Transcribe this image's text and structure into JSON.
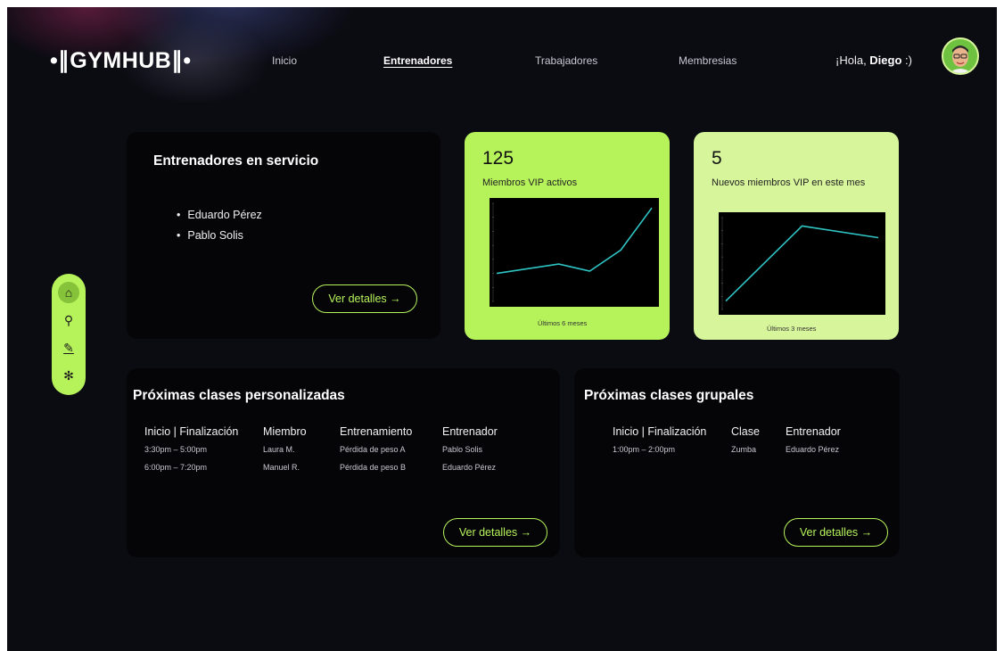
{
  "header": {
    "logo": "•∥GYMHUB∥•",
    "nav": [
      {
        "label": "Inicio"
      },
      {
        "label": "Entrenadores"
      },
      {
        "label": "Trabajadores"
      },
      {
        "label": "Membresias"
      }
    ],
    "greeting_prefix": "¡Hola, ",
    "user_name": "Diego",
    "greeting_suffix": " :)"
  },
  "sidebar": {
    "items": [
      {
        "icon": "home-icon",
        "glyph": "⌂"
      },
      {
        "icon": "search-icon",
        "glyph": "⚲"
      },
      {
        "icon": "edit-icon",
        "glyph": "✎"
      },
      {
        "icon": "settings-icon",
        "glyph": "✻"
      }
    ]
  },
  "trainers_card": {
    "title": "Entrenadores en servicio",
    "trainers": [
      "Eduardo Pérez",
      "Pablo Solis"
    ],
    "button": "Ver detalles →"
  },
  "vip_active": {
    "value": "125",
    "label": "Miembros VIP activos",
    "caption": "Últimos 6 meses"
  },
  "vip_new": {
    "value": "5",
    "label": "Nuevos miembros VIP en este mes",
    "caption": "Últimos 3 meses"
  },
  "personal_classes": {
    "title": "Próximas clases personalizadas",
    "headers": [
      "Inicio | Finalización",
      "Miembro",
      "Entrenamiento",
      "Entrenador"
    ],
    "rows": [
      [
        "3:30pm – 5:00pm",
        "Laura M.",
        "Pérdida de peso A",
        "Pablo Solis"
      ],
      [
        "6:00pm – 7:20pm",
        "Manuel R.",
        "Pérdida de peso B",
        "Eduardo Pérez"
      ]
    ],
    "button": "Ver detalles →"
  },
  "group_classes": {
    "title": "Próximas clases grupales",
    "headers": [
      "Inicio | Finalización",
      "Clase",
      "Entrenador"
    ],
    "rows": [
      [
        "1:00pm – 2:00pm",
        "Zumba",
        "Eduardo Pérez"
      ]
    ],
    "button": "Ver detalles →"
  },
  "colors": {
    "accent": "#b6f35b",
    "accent_light": "#d7f59b",
    "background": "#0b0b12",
    "card": "#050508",
    "line": "#2fc4c4"
  },
  "chart_data": [
    {
      "type": "line",
      "x": [
        1,
        2,
        3,
        4,
        5,
        6
      ],
      "series": [
        {
          "values": [
            12,
            14,
            16,
            13,
            22,
            40
          ]
        }
      ],
      "ylim": [
        0,
        42
      ],
      "grid": false
    },
    {
      "type": "line",
      "x": [
        1,
        2,
        3
      ],
      "series": [
        {
          "values": [
            1,
            10,
            8.6
          ]
        }
      ],
      "ylim": [
        0,
        11
      ],
      "grid": false
    }
  ]
}
